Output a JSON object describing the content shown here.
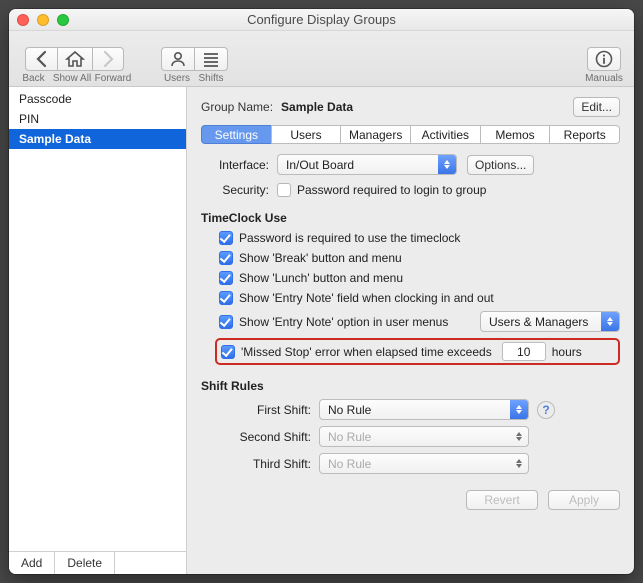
{
  "window": {
    "title": "Configure Display Groups"
  },
  "toolbar": {
    "back": "Back",
    "showall": "Show All",
    "forward": "Forward",
    "users": "Users",
    "shifts": "Shifts",
    "manuals": "Manuals"
  },
  "sidebar": {
    "items": [
      "Passcode",
      "PIN",
      "Sample Data"
    ],
    "selectedIndex": 2,
    "add": "Add",
    "delete": "Delete"
  },
  "content": {
    "groupNameLabel": "Group Name:",
    "groupNameValue": "Sample Data",
    "edit": "Edit...",
    "tabs": [
      "Settings",
      "Users",
      "Managers",
      "Activities",
      "Memos",
      "Reports"
    ],
    "activeTab": 0,
    "interfaceLabel": "Interface:",
    "interfaceValue": "In/Out Board",
    "options": "Options...",
    "securityLabel": "Security:",
    "securityCheck": "Password required to login to group",
    "tcHeader": "TimeClock Use",
    "tc": {
      "pw": "Password is required to use the timeclock",
      "break": "Show 'Break' button and menu",
      "lunch": "Show 'Lunch' button and menu",
      "entryNote": "Show 'Entry Note' field when clocking in and out",
      "entryMenu": "Show 'Entry Note' option in user menus",
      "entryMenuSelect": "Users & Managers",
      "missed": "'Missed Stop' error when elapsed time exceeds",
      "missedValue": "10",
      "missedUnits": "hours"
    },
    "shiftHeader": "Shift Rules",
    "shift1Label": "First Shift:",
    "shift1Value": "No Rule",
    "shift2Label": "Second Shift:",
    "shift2Value": "No Rule",
    "shift3Label": "Third Shift:",
    "shift3Value": "No Rule",
    "revert": "Revert",
    "apply": "Apply"
  }
}
